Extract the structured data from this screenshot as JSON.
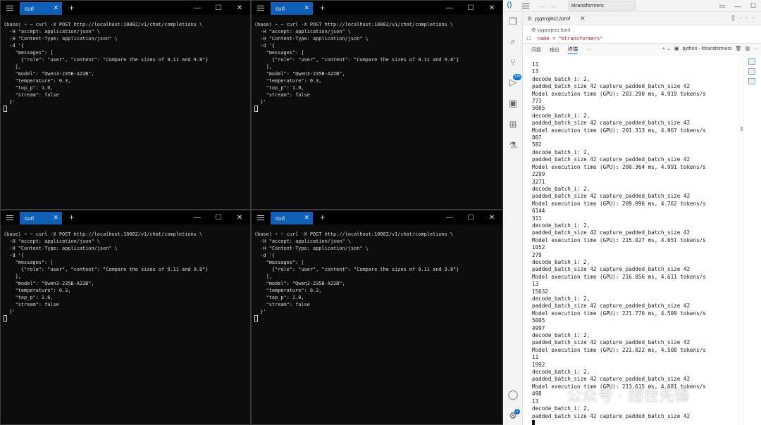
{
  "terminals": [
    {
      "tab_title": "curl",
      "lines": {
        "l1_prefix": "(base) ",
        "l1_arrow": "➜",
        "l1_rest": " ~ curl -X POST http://localhost:10002/v1/chat/completions \\",
        "l2": "  -H \"accept: application/json\" \\",
        "l3": "  -H \"Content-Type: application/json\" \\",
        "l4": "  -d '{",
        "l5": "    \"messages\": [",
        "l6": "      {\"role\": \"user\", \"content\": \"Compare the sizes of 9.11 and 9.8\"}",
        "l7": "    ],",
        "l8": "    \"model\": \"Qwen3-235B-A22B\",",
        "l9": "    \"temperature\": 0.3,",
        "l10": "    \"top_p\": 1.0,",
        "l11": "    \"stream\": false",
        "l12": "  }'"
      }
    }
  ],
  "window_controls": {
    "minimize": "—",
    "maximize": "☐",
    "close": "✕"
  },
  "vscode": {
    "search_text": "ktransformers",
    "editor_tab": "pyproject.toml",
    "breadcrumb": "pyproject.toml",
    "code_line_number": "12",
    "code_line_text": "name = \"ktransformers\"",
    "panel_tabs": [
      "问题",
      "输出",
      "终端",
      "···"
    ],
    "panel_right_label": "python - ktransformers",
    "activity_badge": "335",
    "account_badge": "2",
    "terminal_output": [
      "11",
      "13",
      "decode_batch_i: 2,",
      "padded_batch_size 42 capture_padded_batch_size 42",
      "Model execution time (GPU): 203.290 ms, 4.919 tokens/s",
      "773",
      "5005",
      "decode_batch_i: 2,",
      "padded_batch_size 42 capture_padded_batch_size 42",
      "Model execution time (GPU): 201.313 ms, 4.967 tokens/s",
      "807",
      "582",
      "decode_batch_i: 2,",
      "padded_batch_size 42 capture_padded_batch_size 42",
      "Model execution time (GPU): 200.364 ms, 4.991 tokens/s",
      "2299",
      "3271",
      "decode_batch_i: 2,",
      "padded_batch_size 42 capture_padded_batch_size 42",
      "Model execution time (GPU): 209.996 ms, 4.762 tokens/s",
      "6144",
      "311",
      "decode_batch_i: 2,",
      "padded_batch_size 42 capture_padded_batch_size 42",
      "Model execution time (GPU): 215.027 ms, 4.651 tokens/s",
      "1052",
      "279",
      "decode_batch_i: 2,",
      "padded_batch_size 42 capture_padded_batch_size 42",
      "Model execution time (GPU): 216.856 ms, 4.611 tokens/s",
      "13",
      "15632",
      "decode_batch_i: 2,",
      "padded_batch_size 42 capture_padded_batch_size 42",
      "Model execution time (GPU): 221.776 ms, 4.509 tokens/s",
      "5005",
      "4997",
      "decode_batch_i: 2,",
      "padded_batch_size 42 capture_padded_batch_size 42",
      "Model execution time (GPU): 221.822 ms, 4.508 tokens/s",
      "11",
      "1992",
      "decode_batch_i: 2,",
      "padded_batch_size 42 capture_padded_batch_size 42",
      "Model execution time (GPU): 213.615 ms, 4.681 tokens/s",
      "498",
      "13",
      "decode_batch_i: 2,",
      "padded_batch_size 42 capture_padded_batch_size 42"
    ]
  },
  "watermark": "公众号 · 超世先锋",
  "colors": {
    "terminal_bg": "#0c0c0c",
    "tab_blue": "#0e5fb8",
    "prompt_arrow": "#4ec24e",
    "vscode_blue": "#0d6fd1"
  }
}
